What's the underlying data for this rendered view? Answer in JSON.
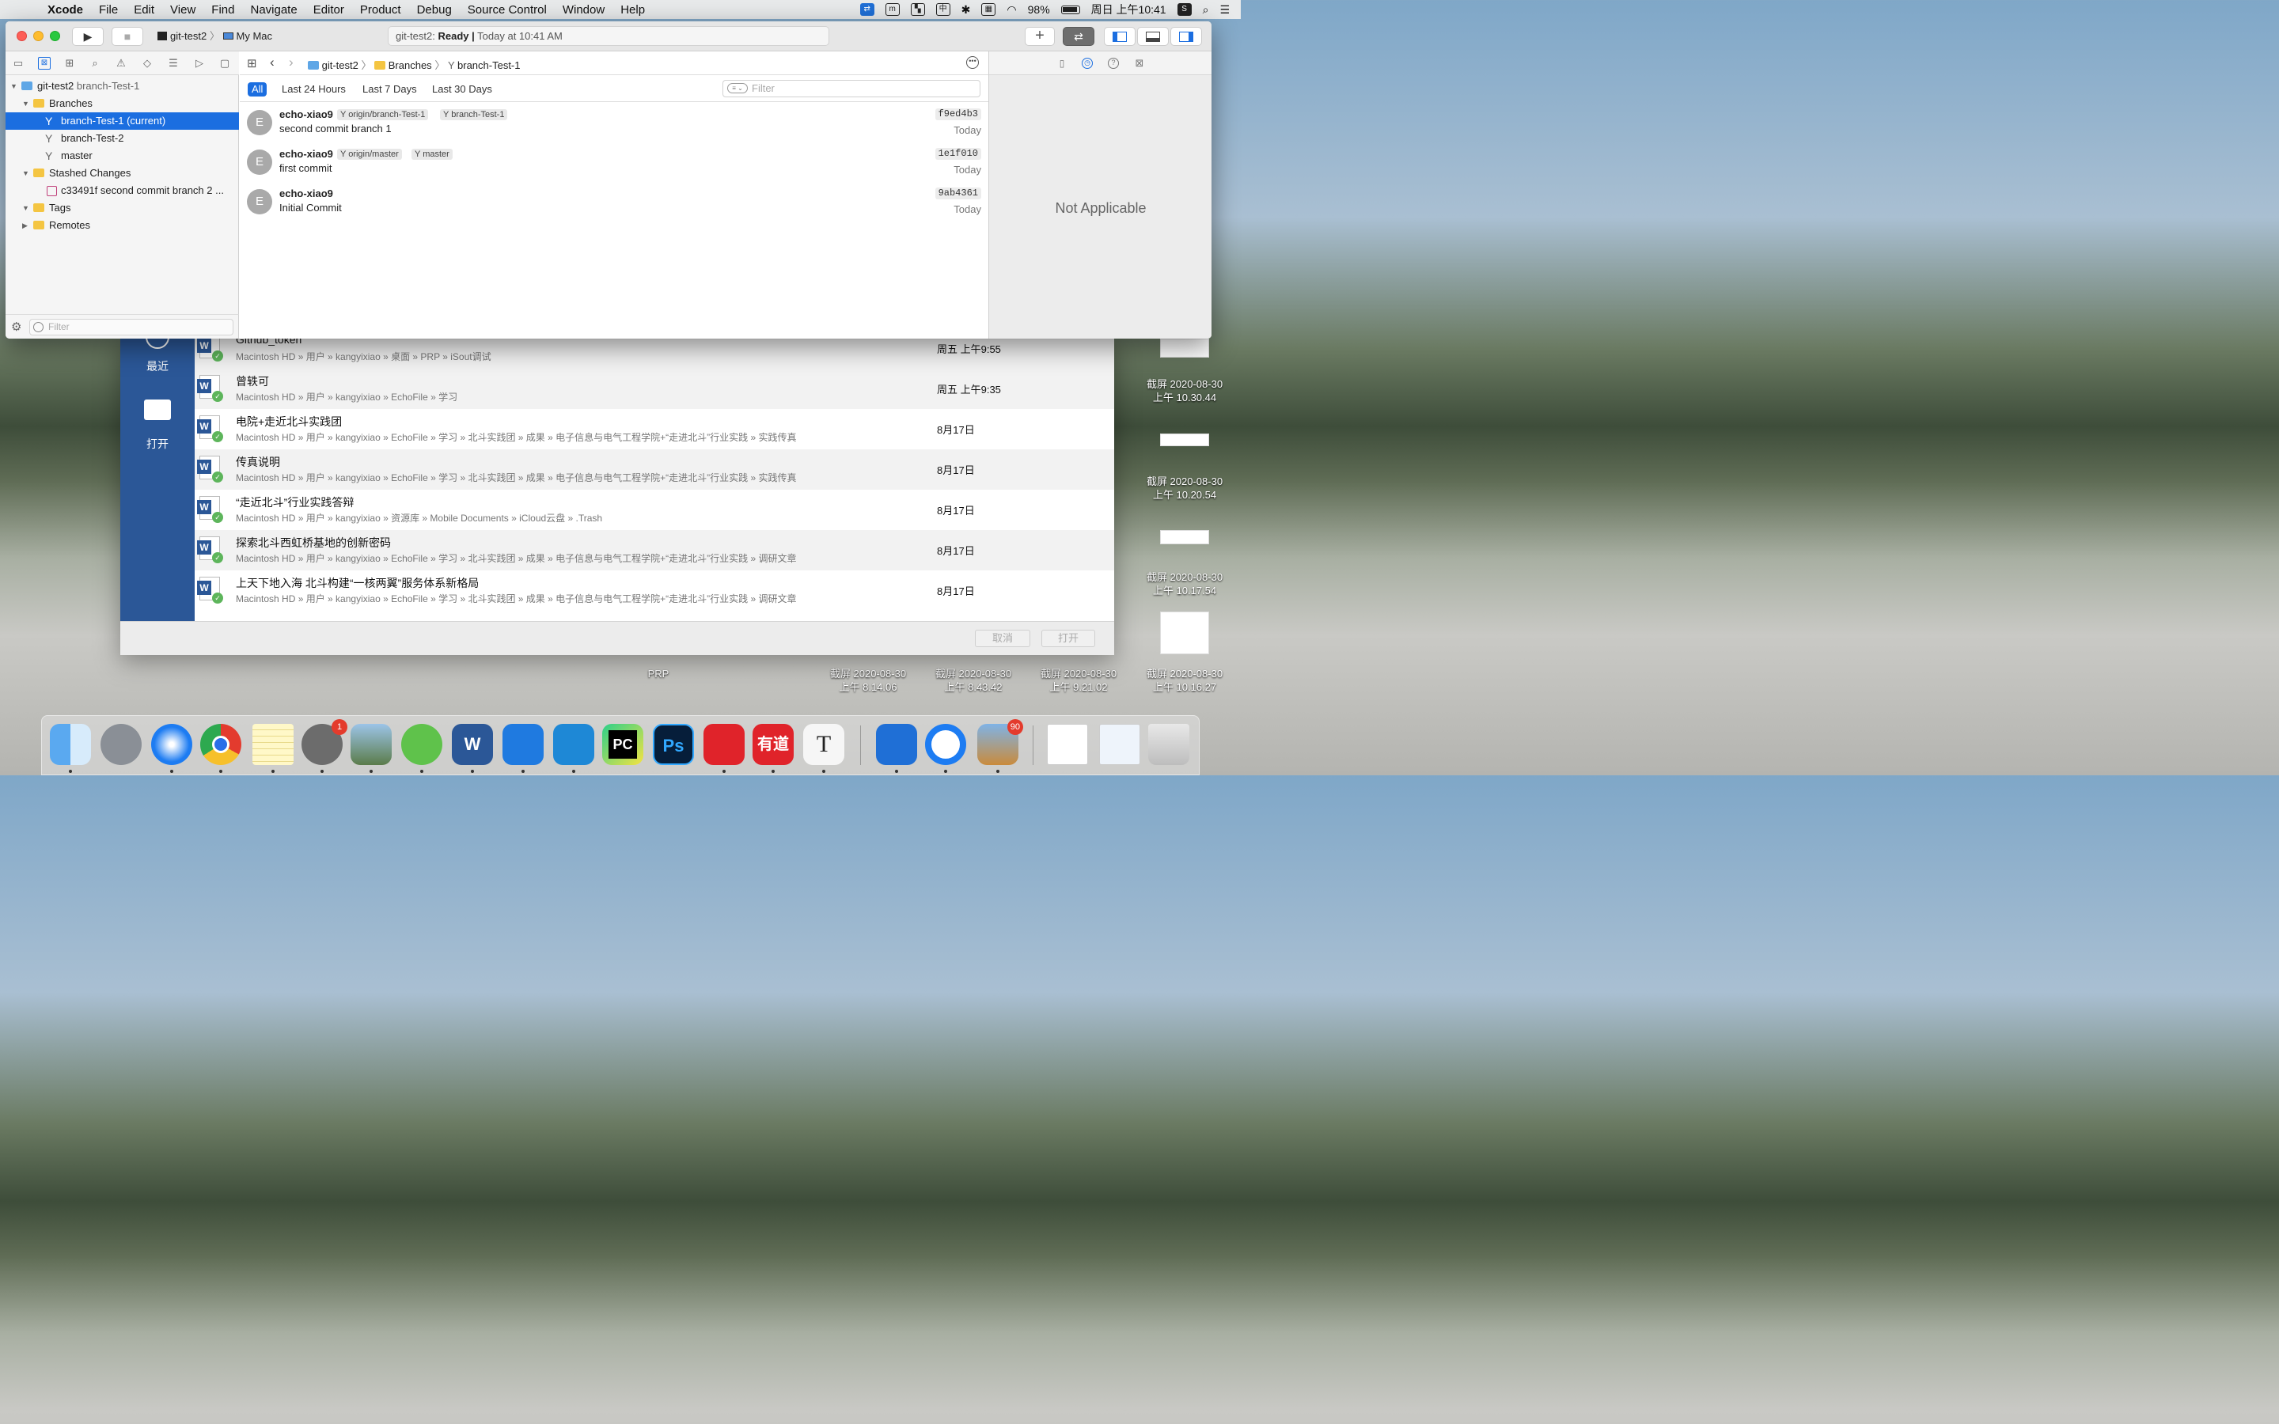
{
  "menubar": {
    "app_name": "Xcode",
    "menus": [
      "File",
      "Edit",
      "View",
      "Find",
      "Navigate",
      "Editor",
      "Product",
      "Debug",
      "Source Control",
      "Window",
      "Help"
    ],
    "battery": "98%",
    "clock": "周日 上午10:41"
  },
  "xcode": {
    "scheme": {
      "target": "git-test2",
      "device": "My Mac"
    },
    "activity": {
      "project": "git-test2:",
      "status": "Ready",
      "sep": "|",
      "time": "Today at 10:41 AM"
    },
    "navigator": {
      "root": {
        "name": "git-test2",
        "branch": "branch-Test-1"
      },
      "items": [
        {
          "label": "Branches"
        },
        {
          "label": "branch-Test-1 (current)"
        },
        {
          "label": "branch-Test-2"
        },
        {
          "label": "master"
        },
        {
          "label": "Stashed Changes"
        },
        {
          "label": "c33491f second commit branch 2 ..."
        },
        {
          "label": "Tags"
        },
        {
          "label": "Remotes"
        }
      ],
      "filter_placeholder": "Filter"
    },
    "jumpbar": {
      "project": "git-test2",
      "group": "Branches",
      "branch": "branch-Test-1"
    },
    "filters": {
      "chips": [
        "All",
        "Last 24 Hours",
        "Last 7 Days",
        "Last 30 Days"
      ],
      "search_placeholder": "Filter"
    },
    "commits": [
      {
        "initial": "E",
        "author": "echo-xiao9",
        "tags": [
          "origin/branch-Test-1",
          "branch-Test-1"
        ],
        "message": "second commit branch 1",
        "hash": "f9ed4b3",
        "date": "Today"
      },
      {
        "initial": "E",
        "author": "echo-xiao9",
        "tags": [
          "origin/master",
          "master"
        ],
        "message": "first commit",
        "hash": "1e1f010",
        "date": "Today"
      },
      {
        "initial": "E",
        "author": "echo-xiao9",
        "tags": [],
        "message": "Initial Commit",
        "hash": "9ab4361",
        "date": "Today"
      }
    ],
    "inspector": {
      "empty": "Not Applicable"
    }
  },
  "finder": {
    "sidebar": {
      "recent": "最近",
      "open": "打开"
    },
    "files": [
      {
        "title": "Github_token",
        "path": "Macintosh HD » 用户 » kangyixiao » 桌面 » PRP » iSout调试",
        "date": "周五 上午9:55"
      },
      {
        "title": "曾轶可",
        "path": "Macintosh HD » 用户 » kangyixiao » EchoFile » 学习",
        "date": "周五 上午9:35"
      },
      {
        "title": "电院+走近北斗实践团",
        "path": "Macintosh HD » 用户 » kangyixiao » EchoFile » 学习 » 北斗实践团 » 成果 » 电子信息与电气工程学院+“走进北斗”行业实践 » 实践传真",
        "date": "8月17日"
      },
      {
        "title": "传真说明",
        "path": "Macintosh HD » 用户 » kangyixiao » EchoFile » 学习 » 北斗实践团 » 成果 » 电子信息与电气工程学院+“走进北斗”行业实践 » 实践传真",
        "date": "8月17日"
      },
      {
        "title": "“走近北斗”行业实践答辩",
        "path": "Macintosh HD » 用户 » kangyixiao » 资源库 » Mobile Documents » iCloud云盘 » .Trash",
        "date": "8月17日"
      },
      {
        "title": "探索北斗西虹桥基地的创新密码",
        "path": "Macintosh HD » 用户 » kangyixiao » EchoFile » 学习 » 北斗实践团 » 成果 » 电子信息与电气工程学院+“走进北斗”行业实践 » 调研文章",
        "date": "8月17日"
      },
      {
        "title": "上天下地入海 北斗构建“一核两翼”服务体系新格局",
        "path": "Macintosh HD » 用户 » kangyixiao » EchoFile » 学习 » 北斗实践团 » 成果 » 电子信息与电气工程学院+“走进北斗”行业实践 » 调研文章",
        "date": "8月17日"
      }
    ],
    "buttons": {
      "cancel": "取消",
      "open": "打开"
    }
  },
  "desktop": {
    "labels": [
      {
        "line1": "截屏 2020-08-30",
        "line2": "上午 10.30.44"
      },
      {
        "line1": "截屏 2020-08-30",
        "line2": "上午 10.20.54"
      },
      {
        "line1": "截屏 2020-08-30",
        "line2": "上午 10.17.54"
      },
      {
        "line1": "PRP",
        "line2": ""
      },
      {
        "line1": "截屏 2020-08-30",
        "line2": "上午 8.14.06"
      },
      {
        "line1": "截屏 2020-08-30",
        "line2": "上午 8.43.42"
      },
      {
        "line1": "截屏 2020-08-30",
        "line2": "上午 9.21.02"
      },
      {
        "line1": "截屏 2020-08-30",
        "line2": "上午 10.16.27"
      }
    ]
  },
  "dock": {
    "badges": {
      "system_preferences": "1",
      "mail_bird": "90"
    },
    "glyphs": {
      "word": "W",
      "pycharm": "PC",
      "photoshop": "Ps",
      "youdao": "有道",
      "typora": "T"
    }
  },
  "colors": {
    "accent": "#1b6ee0",
    "finder_sidebar": "#2b5797"
  }
}
